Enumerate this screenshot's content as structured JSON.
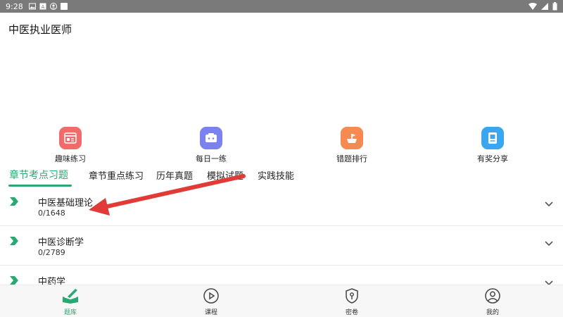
{
  "status_bar": {
    "time": "9:28"
  },
  "app": {
    "title": "中医执业医师"
  },
  "quick_tiles": [
    {
      "label": "趣味练习",
      "icon": "practice-icon",
      "color": "#f26a6a"
    },
    {
      "label": "每日一练",
      "icon": "daily-icon",
      "color": "#7b82f0"
    },
    {
      "label": "错题排行",
      "icon": "ranking-icon",
      "color": "#f58a52"
    },
    {
      "label": "有奖分享",
      "icon": "share-icon",
      "color": "#3aa6f0"
    }
  ],
  "tabs": [
    {
      "label": "章节考点习题",
      "active": true
    },
    {
      "label": "章节重点练习"
    },
    {
      "label": "历年真题"
    },
    {
      "label": "模拟试题"
    },
    {
      "label": "实践技能"
    }
  ],
  "chapters": [
    {
      "title": "中医基础理论",
      "count": "0/1648"
    },
    {
      "title": "中医诊断学",
      "count": "0/2789"
    },
    {
      "title": "中药学",
      "count": ""
    }
  ],
  "bottom_nav": [
    {
      "label": "题库",
      "icon": "question-bank-icon",
      "active": true
    },
    {
      "label": "课程",
      "icon": "play-icon"
    },
    {
      "label": "密卷",
      "icon": "shield-key-icon"
    },
    {
      "label": "我的",
      "icon": "person-icon"
    }
  ],
  "colors": {
    "accent": "#2aa872",
    "status_bar": "#7a7a7a",
    "arrow": "#e03b37"
  }
}
